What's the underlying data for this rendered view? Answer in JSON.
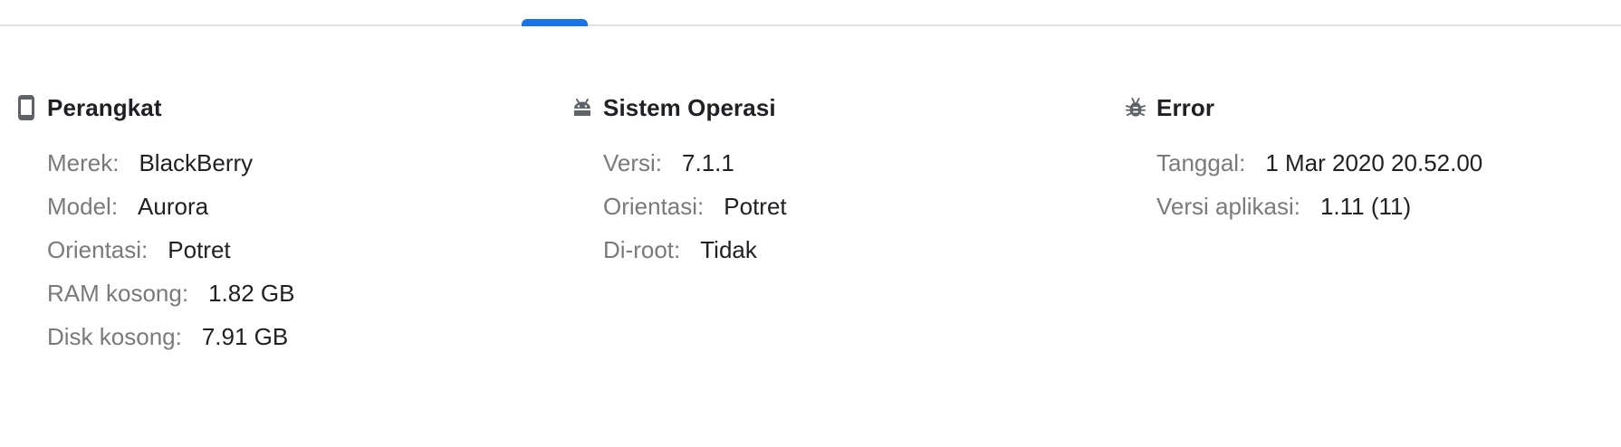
{
  "tabs": {
    "active_color": "#1a73e8"
  },
  "sections": [
    {
      "icon": "smartphone-icon",
      "title": "Perangkat",
      "rows": [
        {
          "label": "Merek:",
          "value": "BlackBerry"
        },
        {
          "label": "Model:",
          "value": "Aurora"
        },
        {
          "label": "Orientasi:",
          "value": "Potret"
        },
        {
          "label": "RAM kosong:",
          "value": "1.82 GB"
        },
        {
          "label": "Disk kosong:",
          "value": "7.91 GB"
        }
      ]
    },
    {
      "icon": "android-icon",
      "title": "Sistem Operasi",
      "rows": [
        {
          "label": "Versi:",
          "value": "7.1.1"
        },
        {
          "label": "Orientasi:",
          "value": "Potret"
        },
        {
          "label": "Di-root:",
          "value": "Tidak"
        }
      ]
    },
    {
      "icon": "bug-icon",
      "title": "Error",
      "rows": [
        {
          "label": "Tanggal:",
          "value": "1 Mar 2020 20.52.00"
        },
        {
          "label": "Versi aplikasi:",
          "value": "1.11 (11)"
        }
      ]
    }
  ]
}
